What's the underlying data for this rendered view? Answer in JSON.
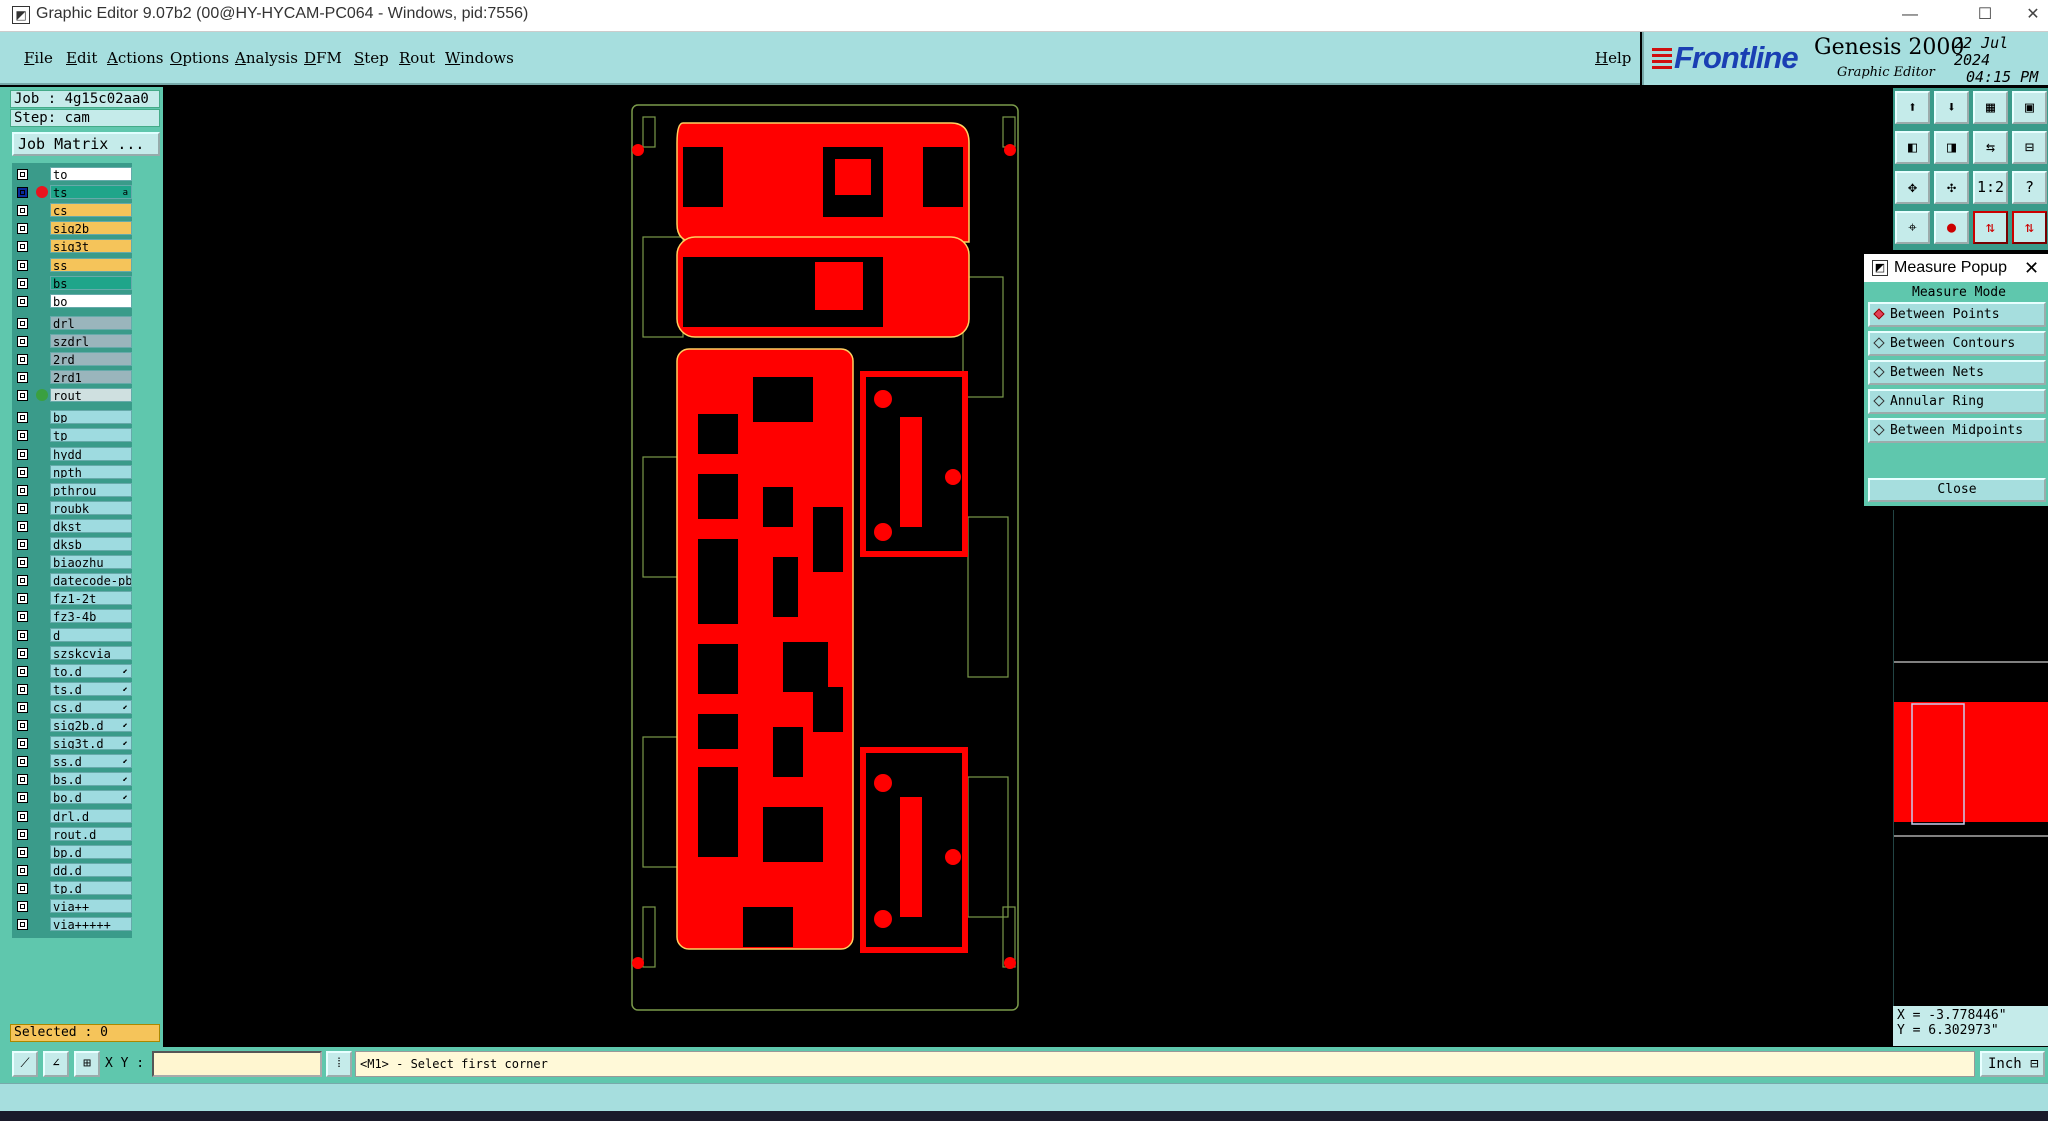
{
  "window": {
    "title": "Graphic Editor 9.07b2 (00@HY-HYCAM-PC064 - Windows, pid:7556)",
    "app_icon": "graphic-editor-icon",
    "minimize": "—",
    "maximize": "☐",
    "close": "✕"
  },
  "menubar": {
    "items": [
      "File",
      "Edit",
      "Actions",
      "Options",
      "Analysis",
      "DFM",
      "Step",
      "Rout",
      "Windows"
    ],
    "help": "Help"
  },
  "brand": {
    "logo": "Frontline",
    "product": "Genesis 2000",
    "subtitle": "Graphic Editor",
    "date": "22 Jul 2024",
    "time": "04:15 PM"
  },
  "job": {
    "job_label": "Job : 4g15c02aa0",
    "step_label": "Step: cam",
    "matrix_button": "Job Matrix ..."
  },
  "layers": [
    {
      "name": "to",
      "color": "#ffffff"
    },
    {
      "name": "ts",
      "color": "#1fa58a",
      "active": true,
      "dot": "#e8141e",
      "mark": "a"
    },
    {
      "name": "cs",
      "color": "#f5c45a"
    },
    {
      "name": "sig2b",
      "color": "#f5c45a"
    },
    {
      "name": "sig3t",
      "color": "#f5c45a"
    },
    {
      "name": "ss",
      "color": "#f5c45a"
    },
    {
      "name": "bs",
      "color": "#1fa58a"
    },
    {
      "name": "bo",
      "color": "#ffffff"
    },
    {
      "name": "drl",
      "color": "#9ab5bc",
      "gap": true
    },
    {
      "name": "szdrl",
      "color": "#9ab5bc"
    },
    {
      "name": "2rd",
      "color": "#9ab5bc"
    },
    {
      "name": "2rd1",
      "color": "#9ab5bc"
    },
    {
      "name": "rout",
      "color": "#cfe0e0",
      "dot": "#3aa040"
    },
    {
      "name": "bp",
      "color": "#9edbe0",
      "gap": true
    },
    {
      "name": "tp",
      "color": "#9edbe0"
    },
    {
      "name": "hydd",
      "color": "#9edbe0"
    },
    {
      "name": "npth",
      "color": "#9edbe0"
    },
    {
      "name": "pthrou",
      "color": "#9edbe0"
    },
    {
      "name": "roubk",
      "color": "#9edbe0"
    },
    {
      "name": "dkst",
      "color": "#9edbe0"
    },
    {
      "name": "dksb",
      "color": "#9edbe0"
    },
    {
      "name": "biaozhu",
      "color": "#9edbe0"
    },
    {
      "name": "datecode-pbe",
      "color": "#9edbe0"
    },
    {
      "name": "fz1-2t",
      "color": "#9edbe0"
    },
    {
      "name": "fz3-4b",
      "color": "#9edbe0"
    },
    {
      "name": "d",
      "color": "#9edbe0"
    },
    {
      "name": "szskcvia",
      "color": "#9edbe0"
    },
    {
      "name": "to.d",
      "color": "#9edbe0",
      "mark": "⬋"
    },
    {
      "name": "ts.d",
      "color": "#9edbe0",
      "mark": "⬋"
    },
    {
      "name": "cs.d",
      "color": "#9edbe0",
      "mark": "⬋"
    },
    {
      "name": "sig2b.d",
      "color": "#9edbe0",
      "mark": "⬋"
    },
    {
      "name": "sig3t.d",
      "color": "#9edbe0",
      "mark": "⬋"
    },
    {
      "name": "ss.d",
      "color": "#9edbe0",
      "mark": "⬋"
    },
    {
      "name": "bs.d",
      "color": "#9edbe0",
      "mark": "⬋"
    },
    {
      "name": "bo.d",
      "color": "#9edbe0",
      "mark": "⬋"
    },
    {
      "name": "drl.d",
      "color": "#9edbe0"
    },
    {
      "name": "rout.d",
      "color": "#9edbe0"
    },
    {
      "name": "bp.d",
      "color": "#9edbe0"
    },
    {
      "name": "dd.d",
      "color": "#9edbe0"
    },
    {
      "name": "tp.d",
      "color": "#9edbe0"
    },
    {
      "name": "via++",
      "color": "#9edbe0"
    },
    {
      "name": "via+++++",
      "color": "#9edbe0"
    }
  ],
  "selected": "Selected : 0",
  "toolbar_icons": [
    "home-up-icon",
    "home-down-icon",
    "grid-icon",
    "window-icon",
    "pan-left-icon",
    "pan-right-icon",
    "swap-icon",
    "split-icon",
    "fit-all-icon",
    "fit-profile-icon",
    "scale-1-2-icon",
    "help-icon",
    "snap-icon",
    "measure-icon",
    "layer-compare-icon",
    "layer-compare-alt-icon"
  ],
  "toolbar_glyphs": [
    "⬆",
    "⬇",
    "▦",
    "▣",
    "◧",
    "◨",
    "⇆",
    "⊟",
    "✥",
    "✣",
    "1:2",
    "?",
    "⌖",
    "●",
    "⇅",
    "⇅"
  ],
  "measure_popup": {
    "title": "Measure Popup",
    "close_x": "✕",
    "mode_label": "Measure Mode",
    "options": [
      "Between Points",
      "Between Contours",
      "Between Nets",
      "Annular Ring",
      "Between Midpoints"
    ],
    "selected_index": 0,
    "close_button": "Close"
  },
  "coords": {
    "x": "X = -3.778446\"",
    "y": "Y = 6.302973\""
  },
  "bottom": {
    "xy_label": "X Y :",
    "xy_value": "",
    "message": "<M1> - Select first corner",
    "units": "Inch ⊟"
  },
  "colors": {
    "copper": "#ff0000",
    "profile": "#7a9a4a",
    "background": "#000000",
    "panel": "#5fc7ad",
    "menu": "#a6dede"
  }
}
